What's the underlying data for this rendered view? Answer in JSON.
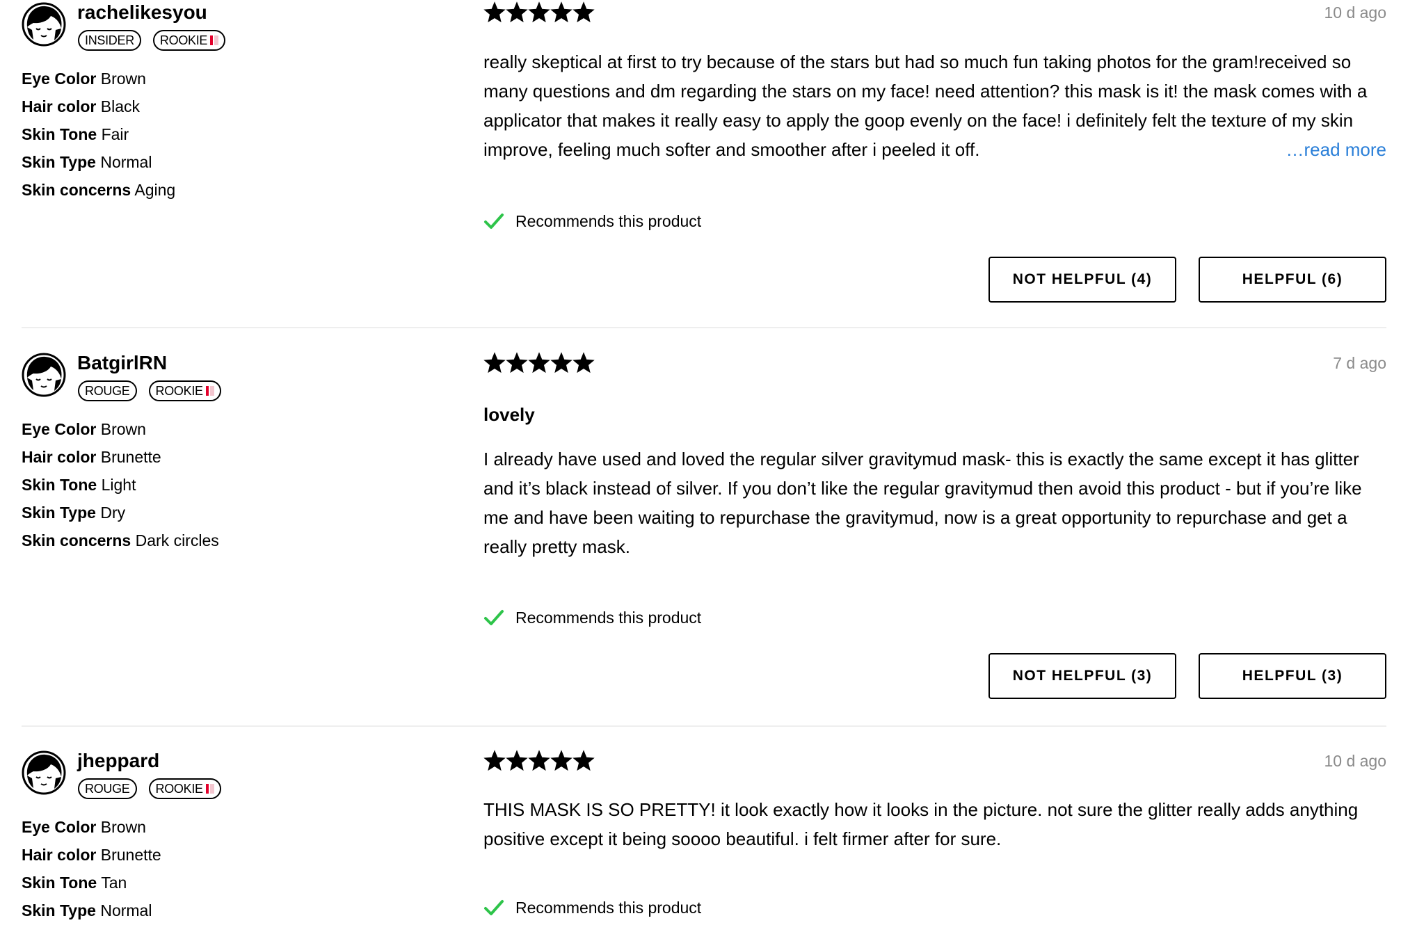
{
  "reviews": [
    {
      "username": "rachelikesyou",
      "badges": [
        "INSIDER",
        "ROOKIE"
      ],
      "attributes": [
        {
          "key": "Eye Color",
          "value": "Brown"
        },
        {
          "key": "Hair color",
          "value": "Black"
        },
        {
          "key": "Skin Tone",
          "value": "Fair"
        },
        {
          "key": "Skin Type",
          "value": "Normal"
        },
        {
          "key": "Skin concerns",
          "value": "Aging"
        }
      ],
      "rating": 5,
      "date": "10 d ago",
      "title": "",
      "text": "really skeptical at first to try because of the stars but had so much fun taking photos for the gram!received so many questions and dm regarding the stars on my face! need attention? this mask is it! the mask comes with a applicator that makes it really easy to apply the goop evenly on the face! i definitely felt the texture of my skin improve, feeling much softer and smoother after i peeled it off.",
      "read_more": "…read more",
      "recommends": "Recommends this product",
      "not_helpful": "NOT HELPFUL (4)",
      "helpful": "HELPFUL (6)"
    },
    {
      "username": "BatgirlRN",
      "badges": [
        "ROUGE",
        "ROOKIE"
      ],
      "attributes": [
        {
          "key": "Eye Color",
          "value": "Brown"
        },
        {
          "key": "Hair color",
          "value": "Brunette"
        },
        {
          "key": "Skin Tone",
          "value": "Light"
        },
        {
          "key": "Skin Type",
          "value": "Dry"
        },
        {
          "key": "Skin concerns",
          "value": "Dark circles"
        }
      ],
      "rating": 5,
      "date": "7 d ago",
      "title": "lovely",
      "text": "I already have used and loved the regular silver gravitymud mask- this is exactly the same except it has glitter and it’s black instead of silver. If you don’t like the regular gravitymud then avoid this product - but if you’re like me and have been waiting to repurchase the gravitymud, now is a great opportunity to repurchase and get a really pretty mask.",
      "recommends": "Recommends this product",
      "not_helpful": "NOT HELPFUL (3)",
      "helpful": "HELPFUL (3)"
    },
    {
      "username": "jheppard",
      "badges": [
        "ROUGE",
        "ROOKIE"
      ],
      "attributes": [
        {
          "key": "Eye Color",
          "value": "Brown"
        },
        {
          "key": "Hair color",
          "value": "Brunette"
        },
        {
          "key": "Skin Tone",
          "value": "Tan"
        },
        {
          "key": "Skin Type",
          "value": "Normal"
        }
      ],
      "rating": 5,
      "date": "10 d ago",
      "title": "",
      "text": "THIS MASK IS SO PRETTY! it look exactly how it looks in the picture. not sure the glitter really adds anything positive except it being soooo beautiful. i felt firmer after for sure.",
      "recommends": "Recommends this product"
    }
  ],
  "colors": {
    "link": "#2a7fd8",
    "check": "#2ec44a",
    "rookie_red": "#e3002b",
    "date_gray": "#8a8a8a"
  }
}
